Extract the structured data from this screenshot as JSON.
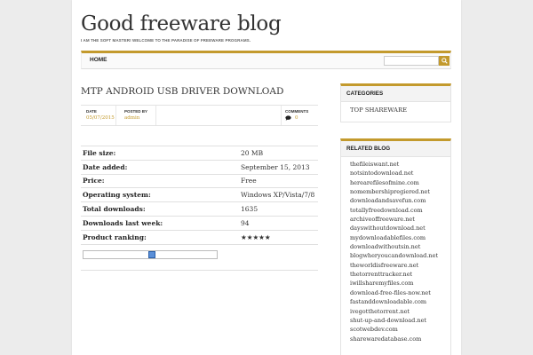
{
  "site": {
    "title": "Good freeware blog",
    "tagline": "I AM THE SOFT MASTER! WELCOME TO THE PARADISE OF FREEWARE PROGRAMS."
  },
  "nav": {
    "home_label": "HOME",
    "search_placeholder": ""
  },
  "post": {
    "title": "MTP ANDROID USB DRIVER DOWNLOAD",
    "meta": {
      "date_label": "DATE",
      "date_value": "05/07/2015",
      "posted_by_label": "POSTED BY",
      "posted_by_value": "admin",
      "comments_label": "COMMENTS",
      "comments_value": "0"
    },
    "details": [
      {
        "label": "File size:",
        "value": "20 MB"
      },
      {
        "label": "Date added:",
        "value": "September 15, 2013"
      },
      {
        "label": "Price:",
        "value": "Free"
      },
      {
        "label": "Operating system:",
        "value": "Windows XP/Vista/7/8"
      },
      {
        "label": "Total downloads:",
        "value": "1635"
      },
      {
        "label": "Downloads last week:",
        "value": "94"
      },
      {
        "label": "Product ranking:",
        "value": "★★★★★"
      }
    ]
  },
  "sidebar": {
    "categories": {
      "title": "CATEGORIES",
      "items": [
        "TOP SHAREWARE"
      ]
    },
    "related": {
      "title": "RELATED BLOG",
      "items": [
        "thefileiswant.net",
        "notsintodownload.net",
        "herearefilesofmine.com",
        "nomembershipregiered.net",
        "downloadandsavefun.com",
        "totallyfreedownload.com",
        "archiveoffreeware.net",
        "dayswithoutdownload.net",
        "mydownloadablefiles.com",
        "downloadwithoutsin.net",
        "blogwheryoucandownload.net",
        "theworldisfreeware.net",
        "thetorrenttracker.net",
        "iwillsharemyfiles.com",
        "download-free-files-now.net",
        "fastanddownloadable.com",
        "ivegotthetorrent.net",
        "shut-up-and-download.net",
        "scotwebdev.com",
        "sharewaredatabase.com"
      ]
    }
  },
  "colors": {
    "accent": "#c39a2d",
    "page_bg": "#ececec"
  }
}
